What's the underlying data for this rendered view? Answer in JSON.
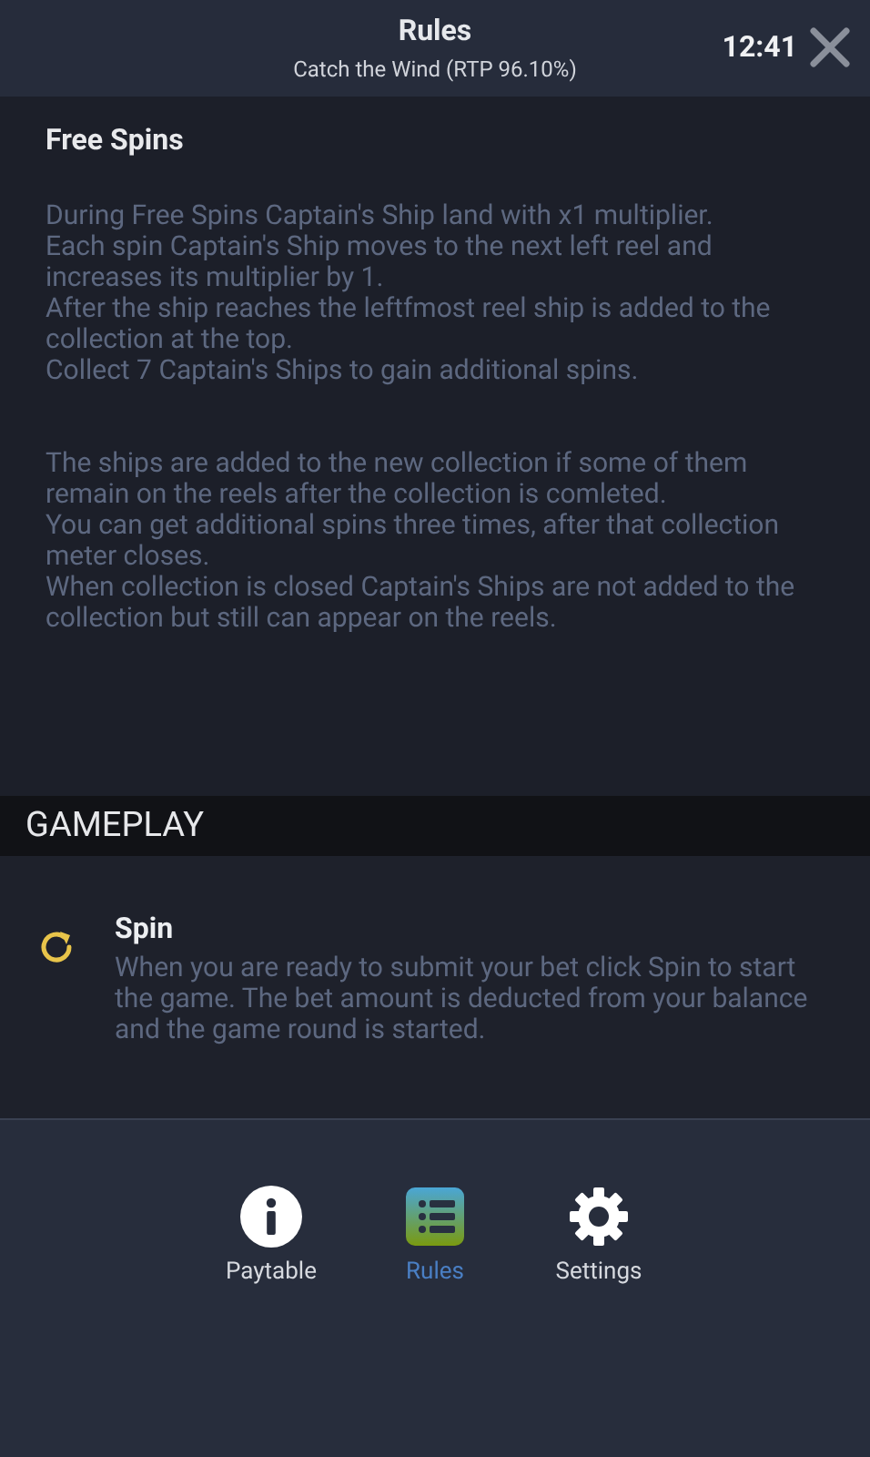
{
  "header": {
    "title": "Rules",
    "subtitle": "Catch the Wind (RTP 96.10%)",
    "time": "12:41"
  },
  "free_spins": {
    "title": "Free Spins",
    "paragraphs": [
      [
        "During Free Spins Captain's Ship land with x1 multiplier.",
        "Each spin Captain's Ship moves to the next left reel and increases its multiplier by 1.",
        "After the ship reaches the leftfmost reel ship is added to the collection at the top.",
        "Collect 7 Captain's Ships to gain additional spins."
      ],
      [
        "The ships are added to the new collection if some of them remain on the reels after the collection is comleted.",
        "You can get additional spins three times, after that collection meter closes.",
        "When collection is closed Captain's Ships are not added to the collection but still can appear on the reels."
      ]
    ]
  },
  "section_heading": "GAMEPLAY",
  "spin": {
    "title": "Spin",
    "description": "When you are ready to submit your bet click Spin to start the game. The bet amount is deducted from your balance and the game round is started."
  },
  "nav": [
    {
      "kind": "info",
      "label": "Paytable",
      "selected": false
    },
    {
      "kind": "list",
      "label": "Rules",
      "selected": true
    },
    {
      "kind": "gear",
      "label": "Settings",
      "selected": false
    }
  ]
}
